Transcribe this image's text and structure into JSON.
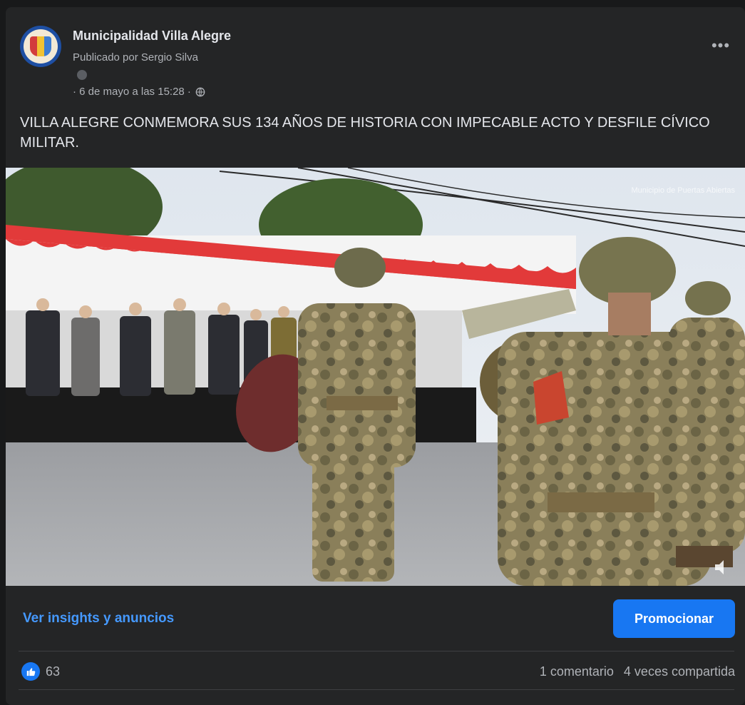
{
  "post": {
    "page_name": "Municipalidad Villa Alegre",
    "published_by": "Publicado por Sergio Silva",
    "date": "· 6 de mayo a las 15:28 ·",
    "text": "VILLA ALEGRE CONMEMORA SUS 134 AÑOS DE HISTORIA CON IMPECABLE ACTO Y DESFILE CÍVICO MILITAR.",
    "more_icon": "more-dots-icon",
    "privacy_icon": "globe-icon"
  },
  "photo": {
    "watermark": "Municipio de Puertas Abiertas"
  },
  "actions": {
    "insights_label": "Ver insights y anuncios",
    "promote_label": "Promocionar"
  },
  "stats": {
    "likes": "63",
    "comments": "1 comentario",
    "shares": "4 veces compartida"
  },
  "colors": {
    "accent": "#1877f2",
    "link": "#4599ff",
    "card": "#242526"
  }
}
